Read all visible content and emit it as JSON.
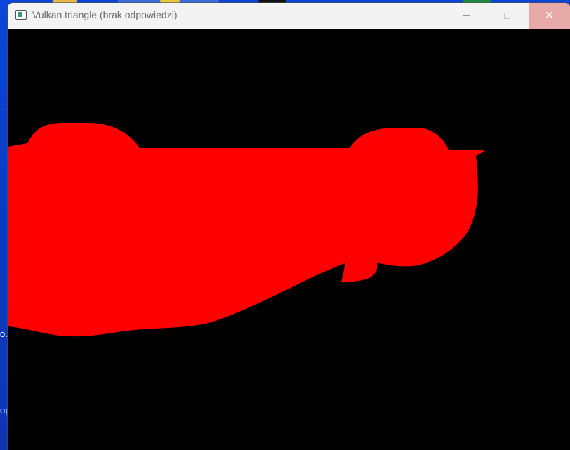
{
  "window": {
    "title": "Vulkan triangle (brak odpowiedzi)",
    "app_icon": "window-app-icon",
    "buttons": {
      "minimize_icon": "minimize-icon",
      "maximize_icon": "maximize-icon",
      "close_icon": "close-icon",
      "close_glyph": "✕"
    }
  },
  "desktop": {
    "fragments": [
      "..",
      "o.",
      "op"
    ]
  },
  "render": {
    "background_color": "#000000",
    "shape_color": "#ff0000"
  }
}
